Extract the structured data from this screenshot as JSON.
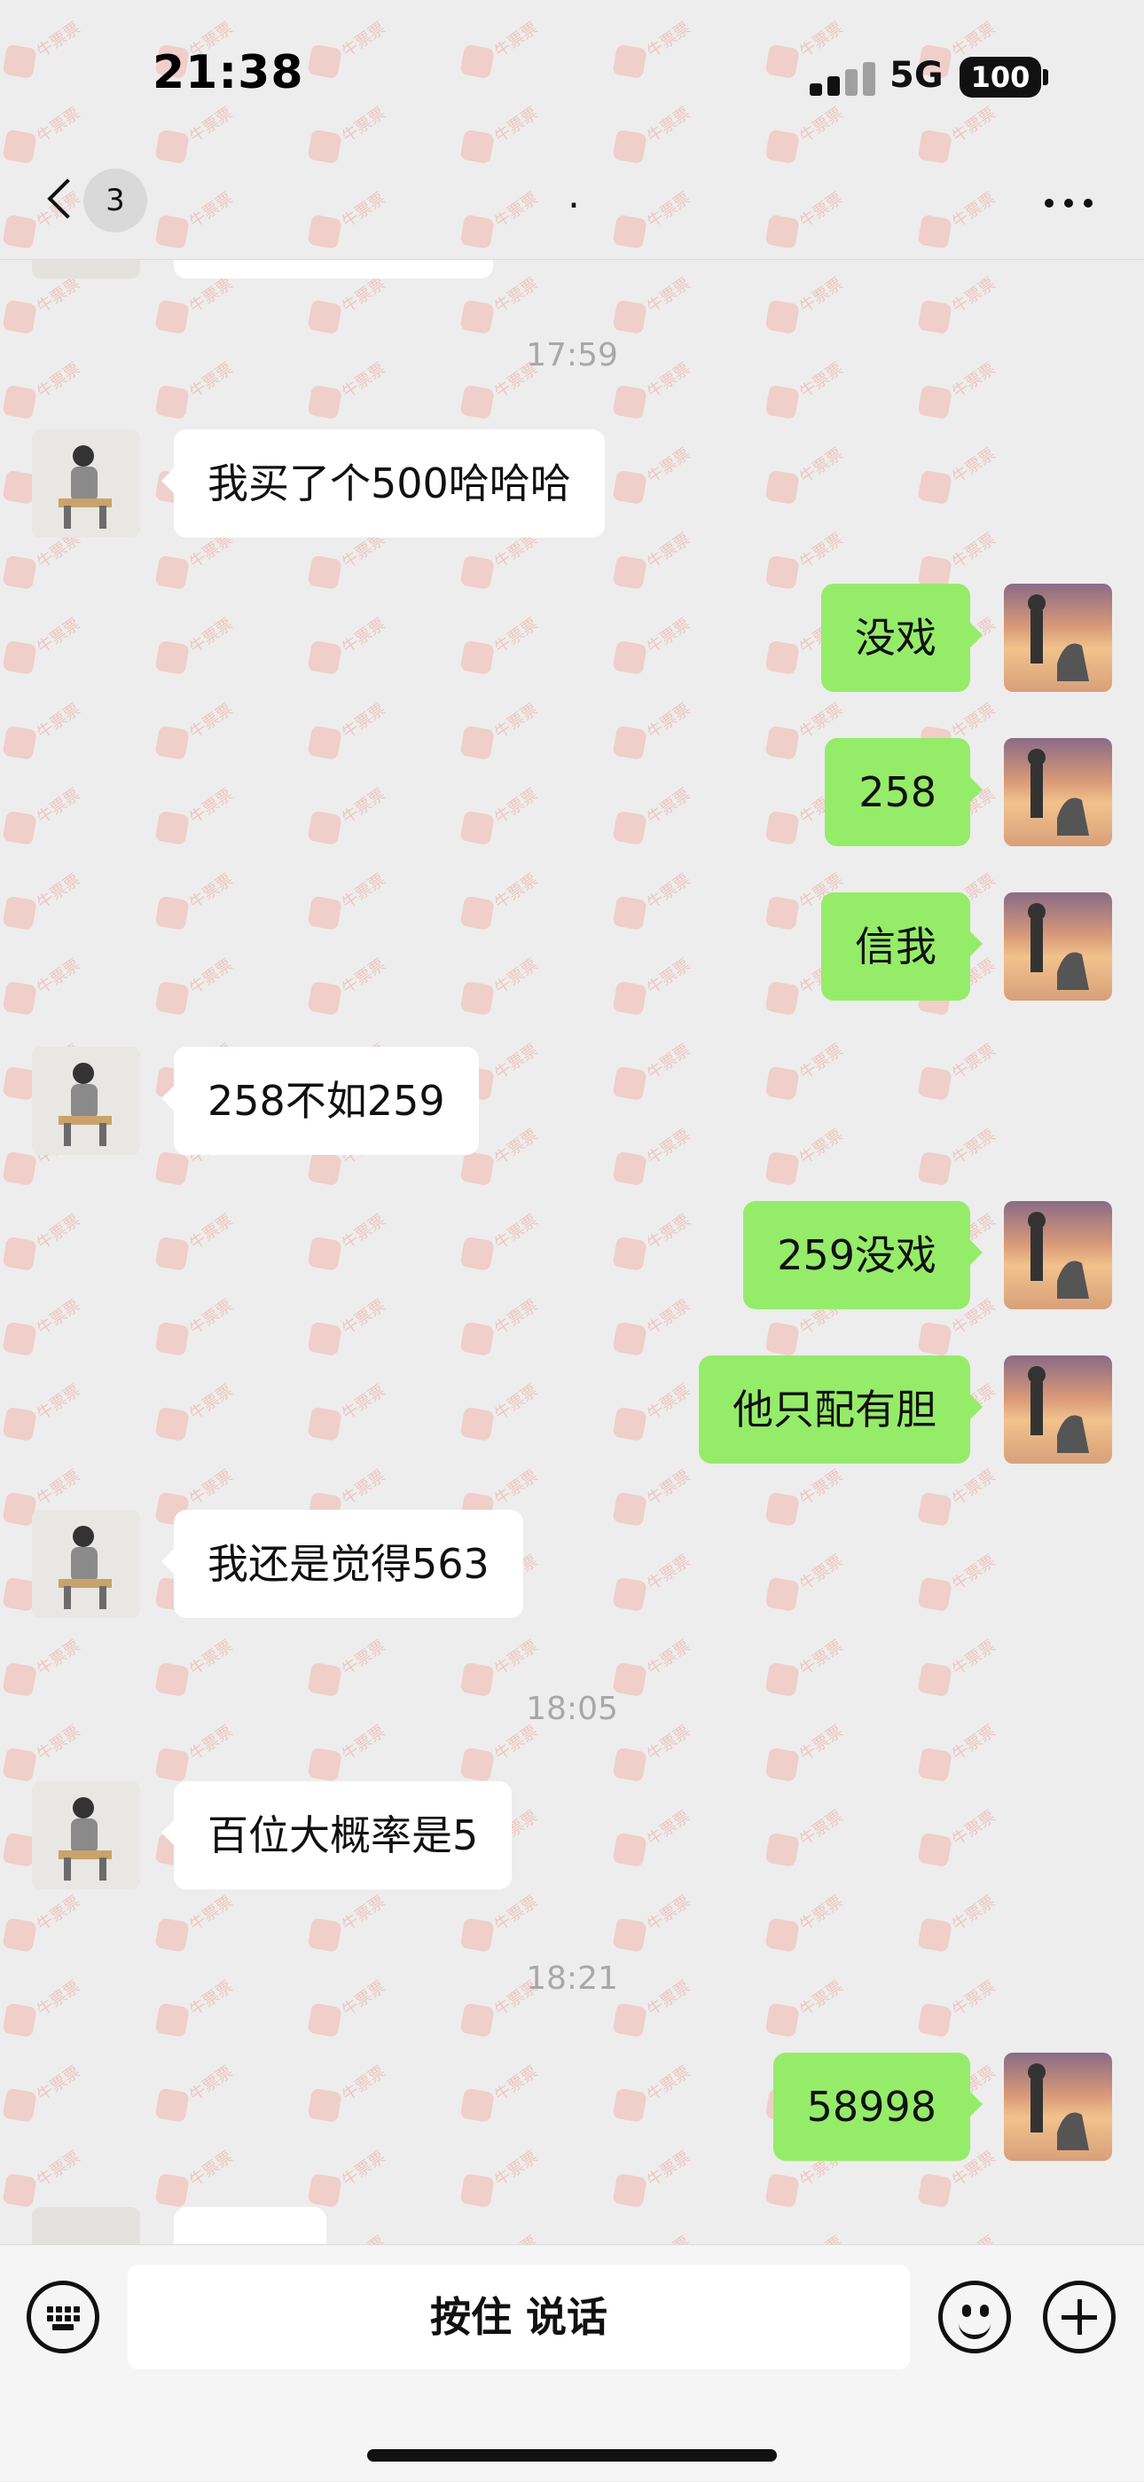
{
  "status_bar": {
    "time": "21:38",
    "network": "5G",
    "battery": "100"
  },
  "nav": {
    "unread_count": "3",
    "title": "."
  },
  "messages": [
    {
      "type": "time",
      "text": "17:59"
    },
    {
      "type": "msg",
      "side": "left",
      "text": "我买了个500哈哈哈"
    },
    {
      "type": "msg",
      "side": "right",
      "text": "没戏"
    },
    {
      "type": "msg",
      "side": "right",
      "text": "258"
    },
    {
      "type": "msg",
      "side": "right",
      "text": "信我"
    },
    {
      "type": "msg",
      "side": "left",
      "text": "258不如259"
    },
    {
      "type": "msg",
      "side": "right",
      "text": "259没戏"
    },
    {
      "type": "msg",
      "side": "right",
      "text": "他只配有胆"
    },
    {
      "type": "msg",
      "side": "left",
      "text": "我还是觉得563"
    },
    {
      "type": "time",
      "text": "18:05"
    },
    {
      "type": "msg",
      "side": "left",
      "text": "百位大概率是5"
    },
    {
      "type": "time",
      "text": "18:21"
    },
    {
      "type": "msg",
      "side": "right",
      "text": "58998"
    }
  ],
  "input_bar": {
    "hold_to_talk": "按住 说话"
  },
  "watermark": "牛票票",
  "colors": {
    "background": "#ededed",
    "bubble_self": "#95ec69",
    "bubble_other": "#ffffff",
    "timestamp": "#a8a8a8"
  }
}
